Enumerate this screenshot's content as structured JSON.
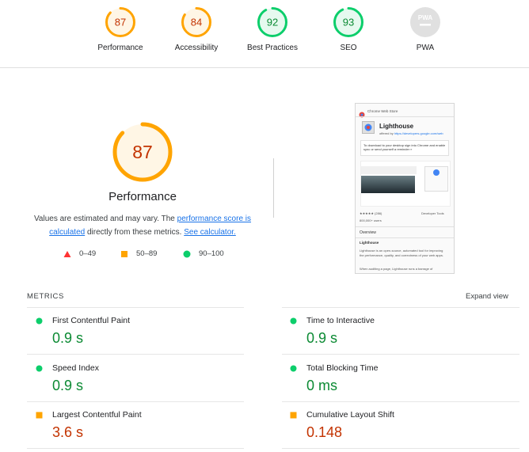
{
  "categories": [
    {
      "name": "Performance",
      "score": 87,
      "status": "average"
    },
    {
      "name": "Accessibility",
      "score": 84,
      "status": "average"
    },
    {
      "name": "Best Practices",
      "score": 92,
      "status": "pass"
    },
    {
      "name": "SEO",
      "score": 93,
      "status": "pass"
    },
    {
      "name": "PWA",
      "score": "PWA",
      "status": "na"
    }
  ],
  "main": {
    "score": 87,
    "title": "Performance",
    "desc_1": "Values are estimated and may vary. The ",
    "desc_link_1": "performance score is calculated",
    "desc_2": " directly from these metrics. ",
    "desc_link_2": "See calculator."
  },
  "legend": [
    {
      "range": "0–49",
      "shape": "triangle",
      "color": "#ff3333"
    },
    {
      "range": "50–89",
      "shape": "square",
      "color": "#ffa400"
    },
    {
      "range": "90–100",
      "shape": "circle",
      "color": "#0cce6b"
    }
  ],
  "thumbnail": {
    "store_name": "Chrome Web Store",
    "ext_title": "Lighthouse",
    "ext_by": "offered by",
    "ext_url": "https://developers.google.com/web",
    "notice": "To download to your desktop sign into Chrome and enable sync or send yourself a reminder »",
    "rating": "★★★★★ (286)",
    "category": "Developer Tools",
    "users": "800,000+ users",
    "tab": "Overview",
    "section": "Lighthouse",
    "body": "Lighthouse is an open-source, automated tool for improving the performance, quality, and correctness of your web apps.",
    "body2": "When auditing a page, Lighthouse runs a barrage of"
  },
  "metrics": {
    "title": "METRICS",
    "expand_label": "Expand view",
    "items": [
      {
        "name": "First Contentful Paint",
        "value": "0.9 s",
        "status": "pass"
      },
      {
        "name": "Time to Interactive",
        "value": "0.9 s",
        "status": "pass"
      },
      {
        "name": "Speed Index",
        "value": "0.9 s",
        "status": "pass"
      },
      {
        "name": "Total Blocking Time",
        "value": "0 ms",
        "status": "pass"
      },
      {
        "name": "Largest Contentful Paint",
        "value": "3.6 s",
        "status": "average"
      },
      {
        "name": "Cumulative Layout Shift",
        "value": "0.148",
        "status": "average"
      }
    ]
  },
  "colors": {
    "pass": "#0cce6b",
    "pass_text": "#0b8a33",
    "pass_bg": "#e6f9ef",
    "average": "#ffa400",
    "average_text": "#c33300",
    "average_bg": "#fff6e5",
    "fail": "#ff3333",
    "na": "#e0e0e0"
  }
}
